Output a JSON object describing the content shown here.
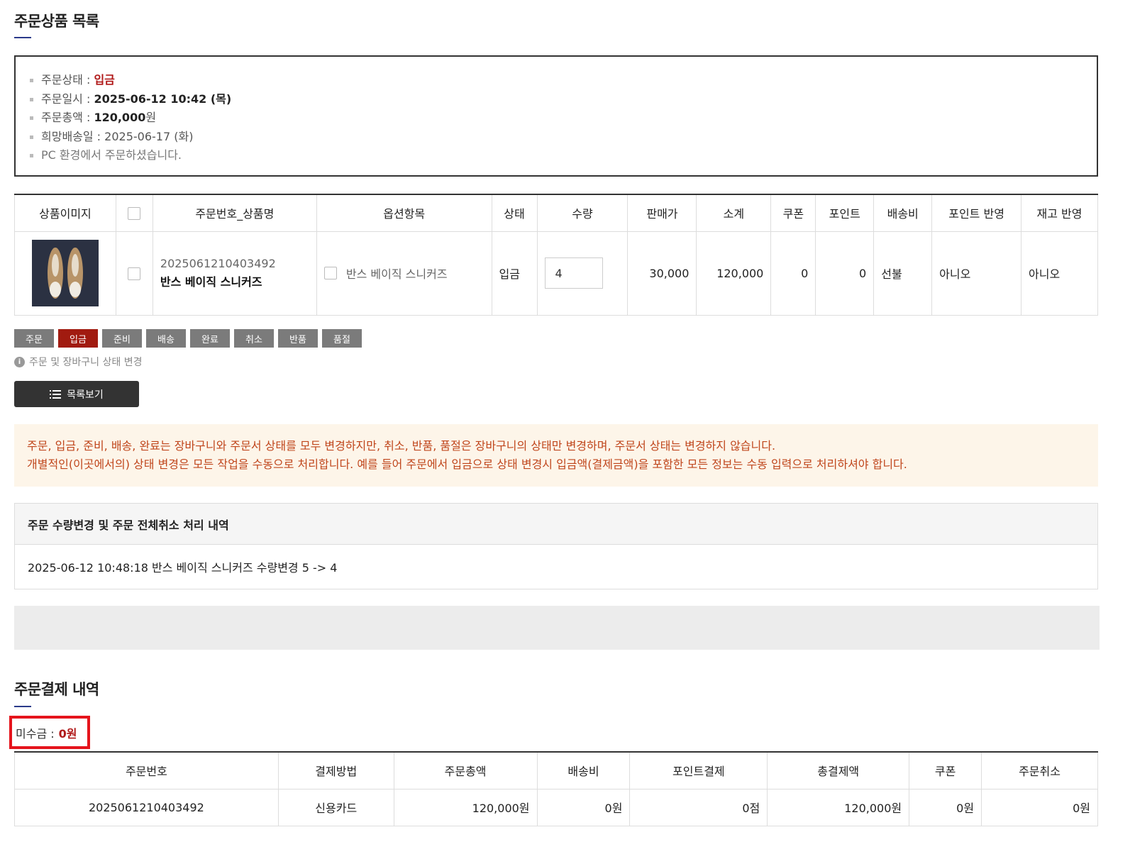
{
  "order_items_section": {
    "title": "주문상품 목록"
  },
  "summary": {
    "status_label": "주문상태 : ",
    "status_value": "입금",
    "date_label": "주문일시 : ",
    "date_value": "2025-06-12 10:42 (목)",
    "total_label": "주문총액 : ",
    "total_value": "120,000",
    "total_unit": "원",
    "delivery_label": "희망배송일 : ",
    "delivery_value": "2025-06-17 (화)",
    "env_note": "PC 환경에서 주문하셨습니다."
  },
  "items_table": {
    "headers": [
      "상품이미지",
      "",
      "주문번호_상품명",
      "옵션항목",
      "상태",
      "수량",
      "판매가",
      "소계",
      "쿠폰",
      "포인트",
      "배송비",
      "포인트 반영",
      "재고 반영"
    ],
    "row": {
      "order_no": "2025061210403492",
      "product_name": "반스 베이직 스니커즈",
      "option": "반스 베이직 스니커즈",
      "status": "입금",
      "quantity": "4",
      "price": "30,000",
      "subtotal": "120,000",
      "coupon": "0",
      "point": "0",
      "shipping": "선불",
      "point_applied": "아니오",
      "stock_applied": "아니오"
    }
  },
  "status_buttons": [
    "주문",
    "입금",
    "준비",
    "배송",
    "완료",
    "취소",
    "반품",
    "품절"
  ],
  "active_status": "입금",
  "help_text": "주문 및 장바구니 상태 변경",
  "list_button_label": "목록보기",
  "notice": {
    "line1": "주문, 입금, 준비, 배송, 완료는 장바구니와 주문서 상태를 모두 변경하지만, 취소, 반품, 품절은 장바구니의 상태만 변경하며, 주문서 상태는 변경하지 않습니다.",
    "line2": "개별적인(이곳에서의) 상태 변경은 모든 작업을 수동으로 처리합니다. 예를 들어 주문에서 입금으로 상태 변경시 입금액(결제금액)을 포함한 모든 정보는 수동 입력으로 처리하셔야 합니다."
  },
  "history": {
    "title": "주문 수량변경 및 주문 전체취소 처리 내역",
    "entry": "2025-06-12 10:48:18 반스 베이직 스니커즈 수량변경 5 -> 4"
  },
  "payment_section": {
    "title": "주문결제 내역"
  },
  "outstanding": {
    "label": "미수금 :",
    "value": "0원"
  },
  "payment_table": {
    "headers": [
      "주문번호",
      "결제방법",
      "주문총액",
      "배송비",
      "포인트결제",
      "총결제액",
      "쿠폰",
      "주문취소"
    ],
    "row": [
      "2025061210403492",
      "신용카드",
      "120,000원",
      "0원",
      "0점",
      "120,000원",
      "0원",
      "0원"
    ]
  },
  "colors": {
    "accent_red": "#a11b10",
    "notice_text": "#c0461c",
    "notice_bg": "#fdf5e9",
    "highlight_box": "#e5141c"
  }
}
